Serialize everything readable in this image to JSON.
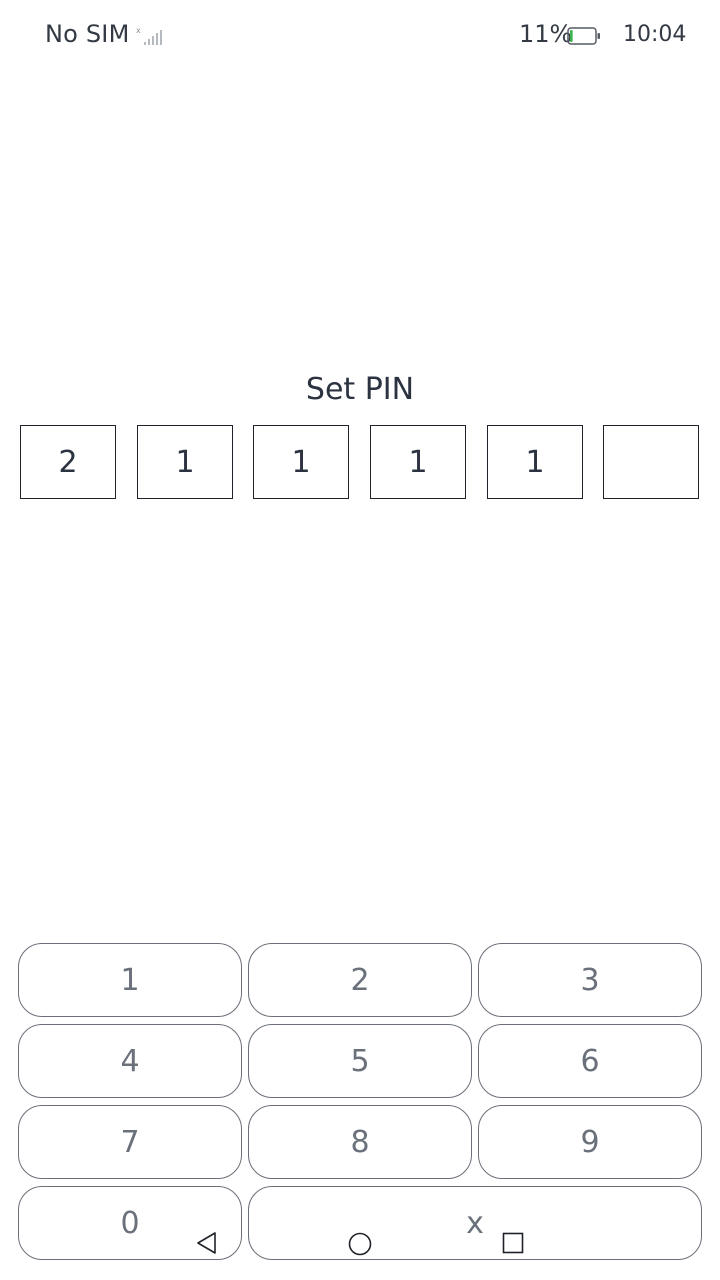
{
  "status_bar": {
    "carrier": "No SIM",
    "battery_percent": "11%",
    "battery_level": 0.11,
    "time": "10:04",
    "signal_icon": "no-signal-icon",
    "battery_icon": "battery-icon"
  },
  "title": "Set PIN",
  "pin": {
    "digits": [
      "2",
      "1",
      "1",
      "1",
      "1",
      ""
    ]
  },
  "keypad": {
    "k1": "1",
    "k2": "2",
    "k3": "3",
    "k4": "4",
    "k5": "5",
    "k6": "6",
    "k7": "7",
    "k8": "8",
    "k9": "9",
    "k0": "0",
    "delete": "x"
  },
  "nav_bar": {
    "back_icon": "back-triangle-icon",
    "home_icon": "home-circle-icon",
    "recent_icon": "recent-square-icon"
  },
  "colors": {
    "text": "#2b3240",
    "key_text": "#6b717b",
    "key_border": "#6a6f78",
    "box_border": "#1f2329",
    "battery_low": "#3cb34a"
  }
}
